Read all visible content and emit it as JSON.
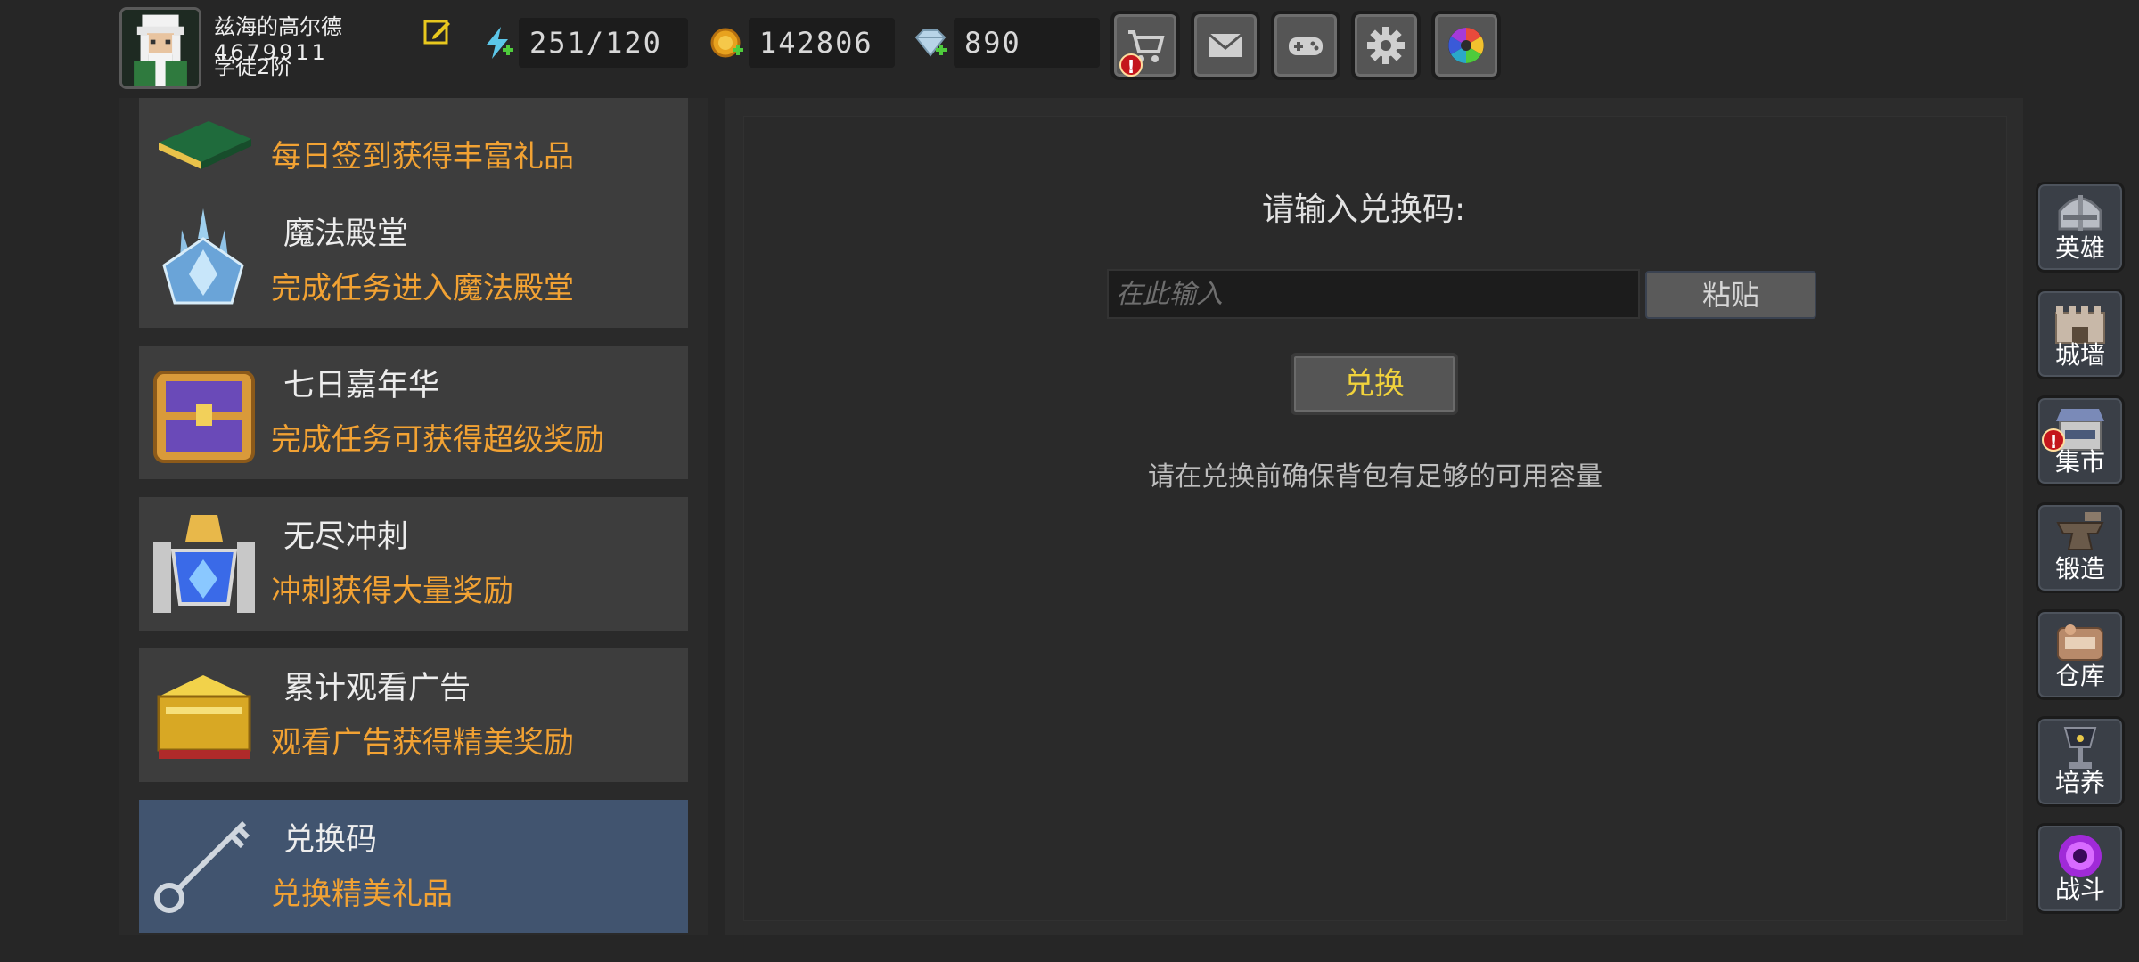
{
  "player": {
    "name": "兹海的高尔德",
    "id": "4679911",
    "rank": "学徒2阶"
  },
  "resources": {
    "energy": "251/120",
    "gold": "142806",
    "gems": "890"
  },
  "top_buttons": [
    "shop",
    "mail",
    "gamepad",
    "settings",
    "camera-aperture"
  ],
  "events": [
    {
      "title": "",
      "desc": "每日签到获得丰富礼品",
      "icon": "book-icon"
    },
    {
      "title": "魔法殿堂",
      "desc": "完成任务进入魔法殿堂",
      "icon": "crystal-icon"
    },
    {
      "title": "七日嘉年华",
      "desc": "完成任务可获得超级奖励",
      "icon": "chest-icon"
    },
    {
      "title": "无尽冲刺",
      "desc": "冲刺获得大量奖励",
      "icon": "trophy-icon"
    },
    {
      "title": "累计观看广告",
      "desc": "观看广告获得精美奖励",
      "icon": "gold-chest-icon"
    },
    {
      "title": "兑换码",
      "desc": "兑换精美礼品",
      "icon": "key-icon",
      "selected": true
    }
  ],
  "redeem": {
    "prompt": "请输入兑换码:",
    "placeholder": "在此输入",
    "paste_label": "粘贴",
    "redeem_label": "兑换",
    "notice": "请在兑换前确保背包有足够的可用容量"
  },
  "right_nav": [
    {
      "label": "英雄",
      "icon": "helmet-icon"
    },
    {
      "label": "城墙",
      "icon": "wall-icon"
    },
    {
      "label": "集市",
      "icon": "market-icon",
      "alert": "!"
    },
    {
      "label": "锻造",
      "icon": "anvil-icon"
    },
    {
      "label": "仓库",
      "icon": "warehouse-icon"
    },
    {
      "label": "培养",
      "icon": "goblet-icon"
    },
    {
      "label": "战斗",
      "icon": "portal-icon"
    }
  ],
  "alerts": {
    "shop": "!"
  },
  "colors": {
    "background": "#262626",
    "item_bg": "#3d3d3d",
    "item_selected": "#41546f",
    "desc_orange": "#f2a233",
    "redeem_yellow": "#f0d23c"
  }
}
